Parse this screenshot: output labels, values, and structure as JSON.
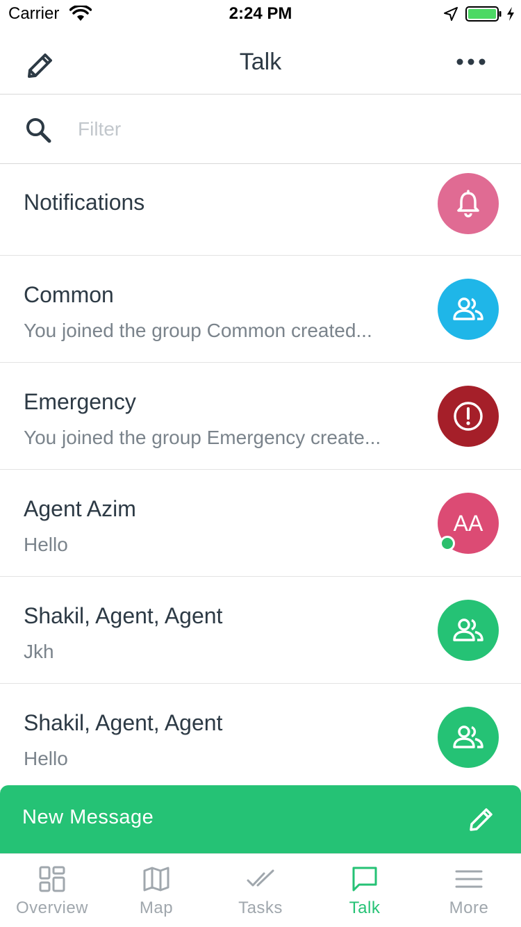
{
  "status_bar": {
    "carrier": "Carrier",
    "time": "2:24 PM"
  },
  "header": {
    "title": "Talk",
    "compose_icon": "pencil-icon",
    "more_icon": "ellipsis-icon"
  },
  "filter": {
    "placeholder": "Filter",
    "value": ""
  },
  "conversations": [
    {
      "title": "Notifications",
      "subtitle": "",
      "avatar_type": "icon",
      "icon": "bell-icon",
      "color": "#e06b93"
    },
    {
      "title": "Common",
      "subtitle": "You joined the group Common created...",
      "avatar_type": "icon",
      "icon": "group-icon",
      "color": "#1fb6e8"
    },
    {
      "title": "Emergency",
      "subtitle": "You joined the group Emergency create...",
      "avatar_type": "icon",
      "icon": "alert-icon",
      "color": "#a51f29"
    },
    {
      "title": "Agent Azim",
      "subtitle": "Hello",
      "avatar_type": "initials",
      "initials": "AA",
      "color": "#dc4b74",
      "online": true
    },
    {
      "title": "Shakil, Agent, Agent",
      "subtitle": "Jkh",
      "avatar_type": "icon",
      "icon": "group-icon",
      "color": "#25c275"
    },
    {
      "title": "Shakil, Agent, Agent",
      "subtitle": "Hello",
      "avatar_type": "icon",
      "icon": "group-icon",
      "color": "#25c275"
    }
  ],
  "new_message": {
    "label": "New Message",
    "icon": "pencil-icon",
    "color": "#25c275"
  },
  "tabs": [
    {
      "label": "Overview",
      "icon": "dashboard-icon",
      "active": false
    },
    {
      "label": "Map",
      "icon": "map-icon",
      "active": false
    },
    {
      "label": "Tasks",
      "icon": "double-check-icon",
      "active": false
    },
    {
      "label": "Talk",
      "icon": "chat-icon",
      "active": true
    },
    {
      "label": "More",
      "icon": "menu-icon",
      "active": false
    }
  ],
  "colors": {
    "accent": "#25c275",
    "inactive_tab": "#a0a7ad",
    "text": "#2d3a45"
  }
}
